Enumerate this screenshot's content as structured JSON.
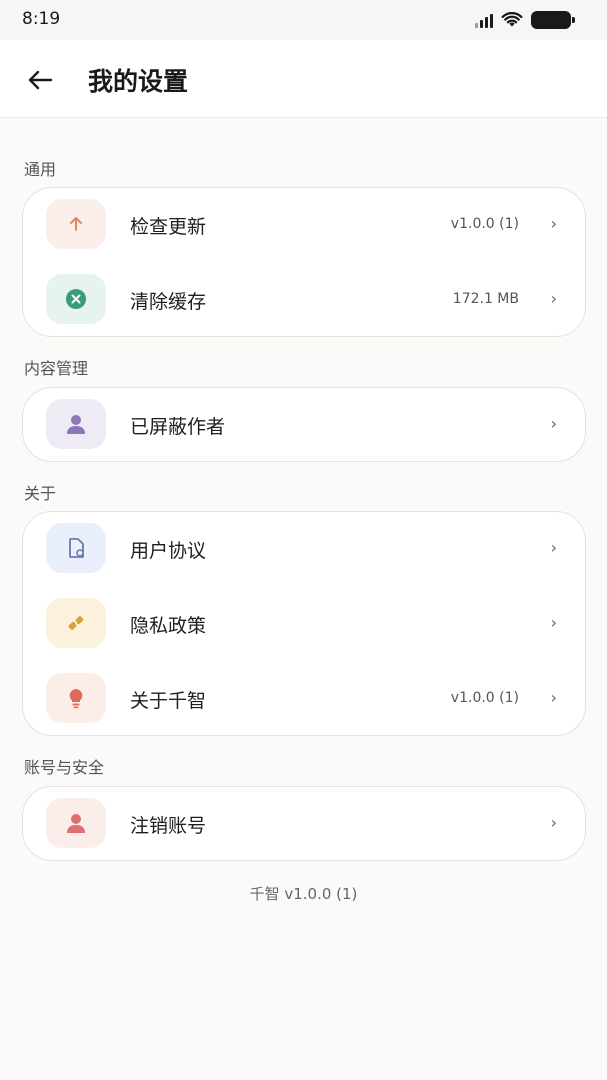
{
  "status": {
    "time": "8:19"
  },
  "header": {
    "title": "我的设置"
  },
  "sections": [
    {
      "label": "通用",
      "items": [
        {
          "label": "检查更新",
          "value": "v1.0.0 (1)",
          "icon": "arrow-up-icon",
          "icon_bg": "#fbeee8",
          "icon_color": "#e0876a"
        },
        {
          "label": "清除缓存",
          "value": "172.1 MB",
          "icon": "clear-circle-icon",
          "icon_bg": "#e6f3ee",
          "icon_color": "#3b9a7c"
        }
      ]
    },
    {
      "label": "内容管理",
      "items": [
        {
          "label": "已屏蔽作者",
          "value": "",
          "icon": "person-icon",
          "icon_bg": "#efebf5",
          "icon_color": "#8c78b8"
        }
      ]
    },
    {
      "label": "关于",
      "items": [
        {
          "label": "用户协议",
          "value": "",
          "icon": "document-icon",
          "icon_bg": "#eaf0fb",
          "icon_color": "#6a7bb0"
        },
        {
          "label": "隐私政策",
          "value": "",
          "icon": "shield-link-icon",
          "icon_bg": "#fbf1dc",
          "icon_color": "#d9a23c"
        },
        {
          "label": "关于千智",
          "value": "v1.0.0 (1)",
          "icon": "lightbulb-icon",
          "icon_bg": "#fbeee8",
          "icon_color": "#e06a5e"
        }
      ]
    },
    {
      "label": "账号与安全",
      "items": [
        {
          "label": "注销账号",
          "value": "",
          "icon": "person-icon",
          "icon_bg": "#fbeeea",
          "icon_color": "#e07070"
        }
      ]
    }
  ],
  "chevron": "›",
  "footer": {
    "version": "千智 v1.0.0 (1)"
  }
}
